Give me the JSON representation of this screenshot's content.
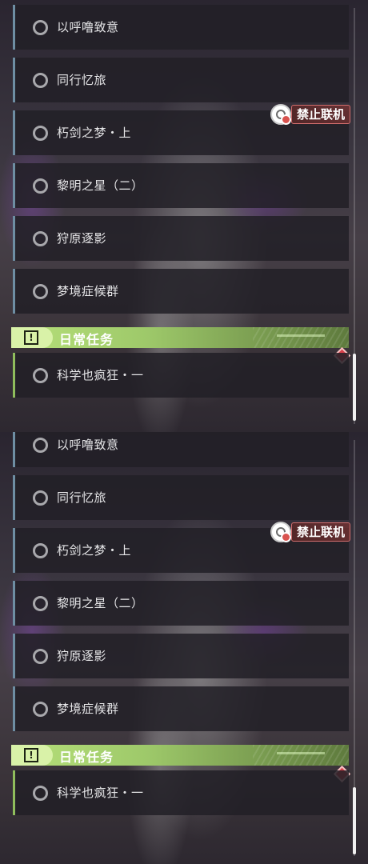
{
  "quests": [
    {
      "label": "以呼噜致意"
    },
    {
      "label": "同行忆旅"
    },
    {
      "label": "朽剑之梦・上"
    },
    {
      "label": "黎明之星（二）"
    },
    {
      "label": "狩原逐影"
    },
    {
      "label": "梦境症候群"
    }
  ],
  "section": {
    "title": "日常任务",
    "badge": "!",
    "daily_quest": "科学也疯狂・一"
  },
  "badge_no_coop": "禁止联机",
  "colors": {
    "accent_green": "#b7e07a",
    "row_border": "#6e8ea3",
    "alert_red": "#d8404a"
  }
}
